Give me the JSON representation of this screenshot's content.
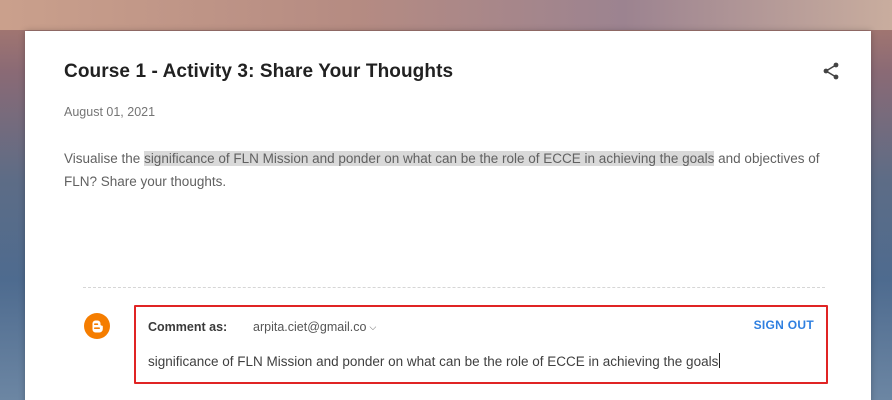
{
  "post": {
    "title": "Course 1 - Activity 3: Share Your Thoughts",
    "date": "August 01, 2021",
    "body_pre": "Visualise the ",
    "body_highlight": "significance of FLN Mission and ponder on what can be the role of ECCE in achieving the goals",
    "body_post": " and objectives of FLN? Share your thoughts.",
    "share_icon": "share-icon"
  },
  "comment": {
    "avatar_icon": "blogger-icon",
    "comment_as_label": "Comment as:",
    "account": "arpita.ciet@gmail.co",
    "sign_out_label": "SIGN OUT",
    "input_value": "significance of FLN Mission and ponder on what can be the role of ECCE in achieving the goals"
  },
  "colors": {
    "highlight": "#d9d9d9",
    "annotation_border": "#e02424",
    "link": "#2e7fe0",
    "blogger_orange": "#f57d00"
  }
}
